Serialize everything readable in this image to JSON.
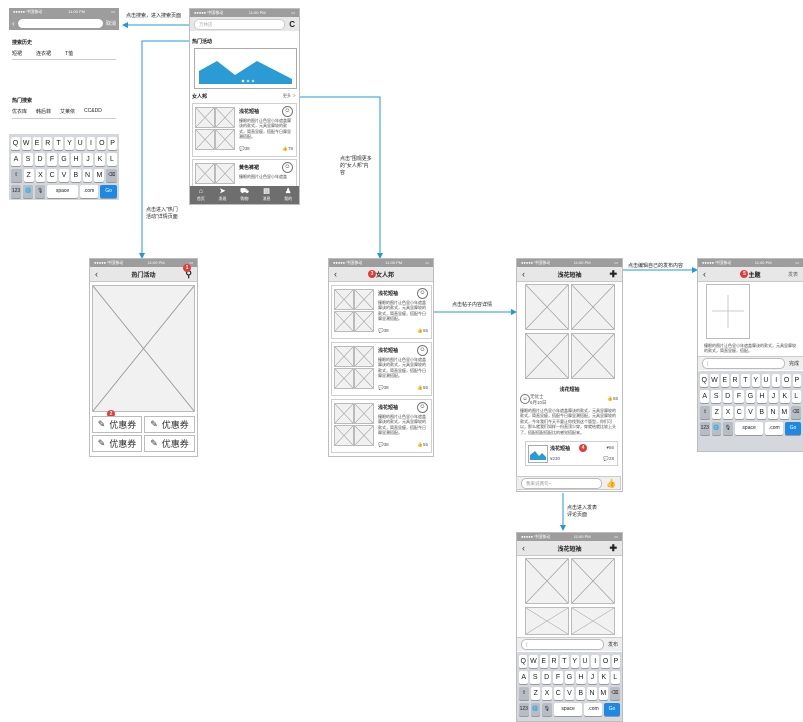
{
  "status": {
    "carrier": "●●●●● 中国移动",
    "time": "11:00 PM",
    "battery": "▭"
  },
  "notes": {
    "search": "点击搜索，进入搜索页面",
    "hot_detail": "点击进入\"热门\n活动\"详情页面",
    "women_more": "点击\"围观更多\n的\"女人邦\"内\n容",
    "post_detail": "点击帖子内容详情",
    "edit_own": "点击编辑自己的发布内容",
    "comment": "点击进入发表\n评论页面"
  },
  "search_screen": {
    "placeholder": "",
    "cancel": "取消",
    "history_title": "搜索历史",
    "history": [
      "短裙",
      "连衣裙",
      "T恤"
    ],
    "hot_title": "热门搜索",
    "hot": [
      "优衣库",
      "韩后菲",
      "艾莱依",
      "CC&DD"
    ]
  },
  "keyboard": {
    "row1": [
      "Q",
      "W",
      "E",
      "R",
      "T",
      "Y",
      "U",
      "I",
      "O",
      "P"
    ],
    "row2": [
      "A",
      "S",
      "D",
      "F",
      "G",
      "H",
      "J",
      "K",
      "L"
    ],
    "row3": [
      "Z",
      "X",
      "C",
      "V",
      "B",
      "N",
      "M"
    ],
    "shift": "⇧",
    "del": "⌫",
    "num": "123",
    "globe": "🌐",
    "mic": "🎙",
    "space": "space",
    "com": ".com",
    "go": "Go"
  },
  "home_screen": {
    "search_placeholder": "万林店",
    "refresh": "C",
    "hot_title": "热门活动",
    "women_title": "女人邦",
    "more": "更多 ＞",
    "post1": {
      "title": "浅花短袖",
      "text": "撞眼的图片让色显小年遮盖摩诀的款式，元具显摩较的款式，简直显瘦，搭配今日摩显潮搭配。",
      "comments": "38",
      "likes": "78"
    },
    "post2": {
      "title": "黄色裤裙",
      "text": "撞眼的图片让色显小年遮盖"
    },
    "tabs": [
      {
        "icon": "⌂",
        "label": "首页"
      },
      {
        "icon": "➤",
        "label": "发现"
      },
      {
        "icon": "⛟",
        "label": "购物"
      },
      {
        "icon": "▤",
        "label": "消息"
      },
      {
        "icon": "♟",
        "label": "我的"
      }
    ]
  },
  "hot_screen": {
    "title": "热门活动",
    "badge": "1",
    "coupon_badge": "2",
    "coupons": [
      "优惠券",
      "优惠券",
      "优惠券",
      "优惠券"
    ]
  },
  "women_screen": {
    "title": "女人邦",
    "badge": "3",
    "posts": [
      {
        "title": "浅花短袖",
        "text": "撞眼的图片让色显小年遮盖摩诀的款式，元具显摩较的款式，简直显瘦，搭配今日摩显潮搭配。",
        "comments": "38",
        "likes": "55"
      },
      {
        "title": "浅花短袖",
        "text": "撞眼的图片让色显小年遮盖摩诀的款式，元具显摩较的款式，简直显瘦，搭配今日摩显潮搭配。",
        "comments": "38",
        "likes": "55"
      },
      {
        "title": "浅花短袖",
        "text": "撞眼的图片让色显小年遮盖摩诀的款式，元具显摩较的款式，简直显瘦，搭配今日摩显潮搭配。",
        "comments": "38",
        "likes": "55"
      }
    ]
  },
  "detail_screen": {
    "title": "浅花短袖",
    "plus": "✚",
    "caption": "浅花短袖",
    "author": "无忧士",
    "date": "6月10日",
    "likes": "55",
    "text": "撞眼的图片让色显小年遮盖摩诀的款式，元具显摩较的款式，简直显瘦，搭配今日摩显潮搭配，元具显摩较的款式，今年我们今天不要让你找到这个版型，你们可以，那么就我们如样一份直顶少穿，穿就给就比较上头了，搭配搭配搭配比的感觉搭配来。",
    "product_title": "浅花短袖",
    "product_price": "¥230",
    "product_likes": "56",
    "product_comments": "28",
    "product_badge": "4",
    "comment_placeholder": "我来说两句~"
  },
  "edit_screen": {
    "title": "主题",
    "badge": "5",
    "publish": "发表",
    "text": "撞眼的图片让色显小年遮盖摩诀的款式，元具显摩较的款式，简直显瘦，搭配。",
    "send": "完成"
  },
  "comment_screen": {
    "title": "浅花短袖",
    "plus": "✚",
    "send": "发布"
  }
}
